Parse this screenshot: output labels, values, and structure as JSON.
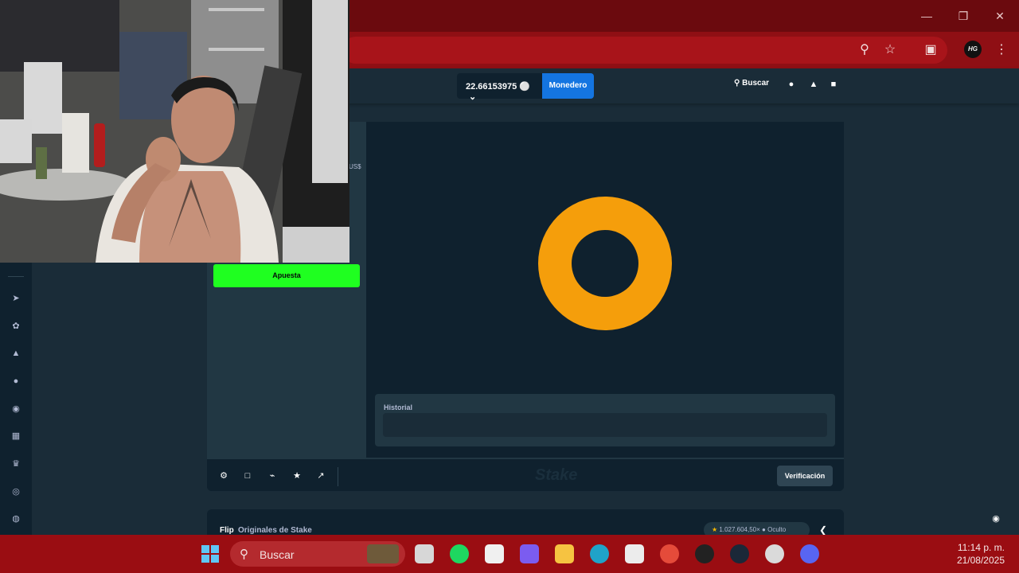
{
  "browser": {
    "window_controls": [
      "minimize-icon",
      "restore-icon",
      "close-icon"
    ],
    "toolbar_icons": [
      "zoom-icon",
      "star-icon",
      "extensions-icon"
    ],
    "profile_initials": "HG",
    "menu_icon": "more-vert-icon"
  },
  "header": {
    "balance": "22.66153975",
    "wallet_label": "Monedero",
    "search_label": "Buscar"
  },
  "game": {
    "bet_label": "Apuesta",
    "partial_currency": "US$",
    "history_label": "Historial",
    "verify_label": "Verificación",
    "watermark": "Stake",
    "coin_color": "#f59e0b",
    "bet_button_color": "#1fff20"
  },
  "info_bar": {
    "game_name": "Flip",
    "game_sub": "Originales de Stake",
    "max_win": "1.027.604,50×",
    "visibility": "Oculto"
  },
  "taskbar": {
    "search_label": "Buscar",
    "time": "11:14 p. m.",
    "date": "21/08/2025"
  }
}
